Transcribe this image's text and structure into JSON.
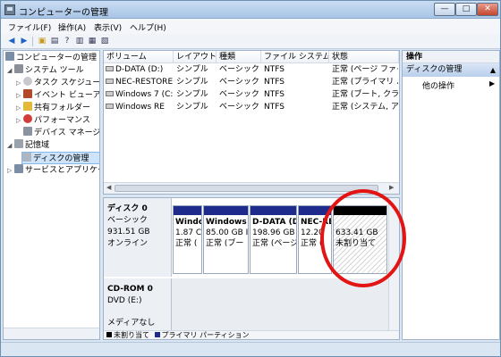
{
  "window": {
    "title": "コンピューターの管理",
    "controls": {
      "minimize": "—",
      "maximize": "□",
      "close": "✕"
    }
  },
  "menu": [
    "ファイル(F)",
    "操作(A)",
    "表示(V)",
    "ヘルプ(H)"
  ],
  "tree": {
    "items": [
      {
        "label": "コンピューターの管理 (",
        "icon": "computer-management-icon",
        "level": 0,
        "arrow": ""
      },
      {
        "label": "システム ツール",
        "icon": "system-tools-icon",
        "level": 1,
        "arrow": "◢"
      },
      {
        "label": "タスク スケジュー",
        "icon": "task-scheduler-icon",
        "level": 2,
        "arrow": "▷"
      },
      {
        "label": "イベント ビューア",
        "icon": "event-viewer-icon",
        "level": 2,
        "arrow": "▷"
      },
      {
        "label": "共有フォルダー",
        "icon": "shared-folder-icon",
        "level": 2,
        "arrow": "▷"
      },
      {
        "label": "パフォーマンス",
        "icon": "performance-icon",
        "level": 2,
        "arrow": "▷"
      },
      {
        "label": "デバイス マネージ",
        "icon": "device-manager-icon",
        "level": 2,
        "arrow": ""
      },
      {
        "label": "記憶域",
        "icon": "storage-icon",
        "level": 1,
        "arrow": "◢"
      },
      {
        "label": "ディスクの管理",
        "icon": "disk-management-icon",
        "level": 2,
        "arrow": "",
        "selected": true
      },
      {
        "label": "サービスとアプリケー",
        "icon": "services-apps-icon",
        "level": 1,
        "arrow": "▷"
      }
    ]
  },
  "volumes": {
    "columns": [
      "ボリューム",
      "レイアウト",
      "種類",
      "ファイル システム",
      "状態"
    ],
    "rows": [
      [
        "D-DATA (D:)",
        "シンプル",
        "ベーシック",
        "NTFS",
        "正常 (ページ ファイ"
      ],
      [
        "NEC-RESTORE",
        "シンプル",
        "ベーシック",
        "NTFS",
        "正常 (プライマリ パ"
      ],
      [
        "Windows 7 (C:)",
        "シンプル",
        "ベーシック",
        "NTFS",
        "正常 (ブート, クラッ"
      ],
      [
        "Windows RE",
        "シンプル",
        "ベーシック",
        "NTFS",
        "正常 (システム, アク"
      ]
    ]
  },
  "disk0": {
    "name": "ディスク 0",
    "type": "ベーシック",
    "size": "931.51 GB",
    "status": "オンライン",
    "partitions": [
      {
        "name": "Windo",
        "size": "1.87 C",
        "status": "正常 (",
        "kind": "primary"
      },
      {
        "name": "Windows",
        "size": "85.00 GB I",
        "status": "正常 (ブー",
        "kind": "primary"
      },
      {
        "name": "D-DATA (D",
        "size": "198.96 GB",
        "status": "正常 (ページ",
        "kind": "primary"
      },
      {
        "name": "NEC-RE",
        "size": "12.20",
        "status": "正常 (",
        "kind": "primary"
      },
      {
        "name": "",
        "size": "633.41 GB",
        "status": "未割り当て",
        "kind": "unallocated"
      }
    ]
  },
  "cdrom0": {
    "name": "CD-ROM 0",
    "drive": "DVD (E:)",
    "media": "メディアなし"
  },
  "legend": [
    {
      "label": "未割り当て",
      "color": "#000000"
    },
    {
      "label": "プライマリ パーティション",
      "color": "#1f2b8c"
    }
  ],
  "operations": {
    "header": "操作",
    "section": "ディスクの管理",
    "item": "他の操作"
  },
  "colors": {
    "primary_partition": "#1f2b8c",
    "unallocated": "#000000",
    "highlight_ring": "#e21414",
    "selection": "#cde3f9"
  }
}
